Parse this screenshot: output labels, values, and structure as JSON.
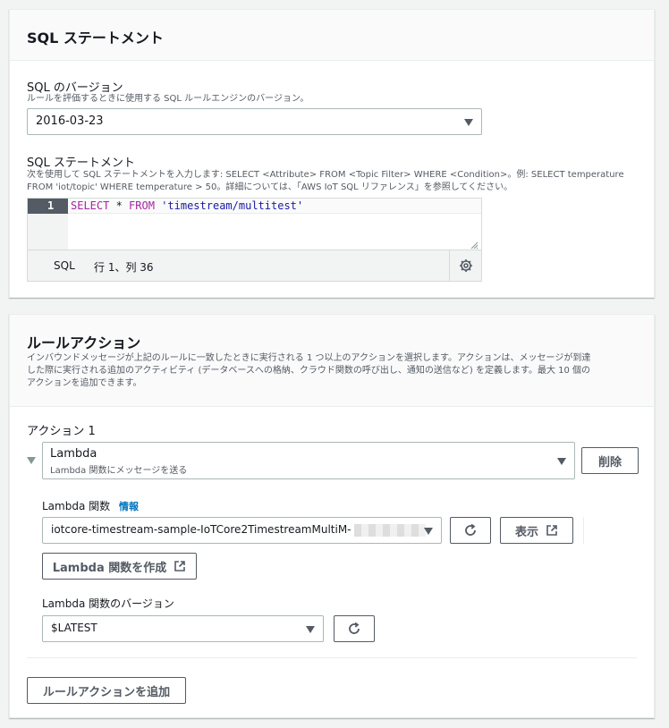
{
  "sql_panel": {
    "title": "SQL ステートメント",
    "version": {
      "label": "SQL のバージョン",
      "description": "ルールを評価するときに使用する SQL ルールエンジンのバージョン。",
      "selected": "2016-03-23"
    },
    "statement": {
      "label": "SQL ステートメント",
      "description_line1": "次を使用して SQL ステートメントを入力します: SELECT <Attribute> FROM <Topic Filter> WHERE <Condition>。例: SELECT temperature",
      "description_line2": "FROM 'iot/topic' WHERE temperature > 50。詳細については、「AWS IoT SQL リファレンス」を参照してください。",
      "line_number": "1",
      "code_select": "SELECT",
      "code_star": " * ",
      "code_from": "FROM",
      "code_string": "'timestream/multitest'",
      "status_mode": "SQL",
      "status_position": "行 1、列 36"
    }
  },
  "actions_panel": {
    "title": "ルールアクション",
    "description_line1": "インバウンドメッセージが上記のルールに一致したときに実行される 1 つ以上のアクションを選択します。アクションは、メッセージが到達",
    "description_line2": "した際に実行される追加のアクティビティ (データベースへの格納、クラウド関数の呼び出し、通知の送信など) を定義します。最大 10 個の",
    "description_line3": "アクションを追加できます。",
    "action_label": "アクション 1",
    "action_select": {
      "title": "Lambda",
      "subtitle": "Lambda 関数にメッセージを送る"
    },
    "delete_button": "削除",
    "lambda_function": {
      "label": "Lambda 関数",
      "info_link": "情報",
      "selected": "iotcore-timestream-sample-IoTCore2TimestreamMultiM-",
      "view_button": "表示",
      "create_button": "Lambda 関数を作成"
    },
    "lambda_version": {
      "label": "Lambda 関数のバージョン",
      "selected": "$LATEST"
    },
    "add_action_button": "ルールアクションを追加"
  }
}
